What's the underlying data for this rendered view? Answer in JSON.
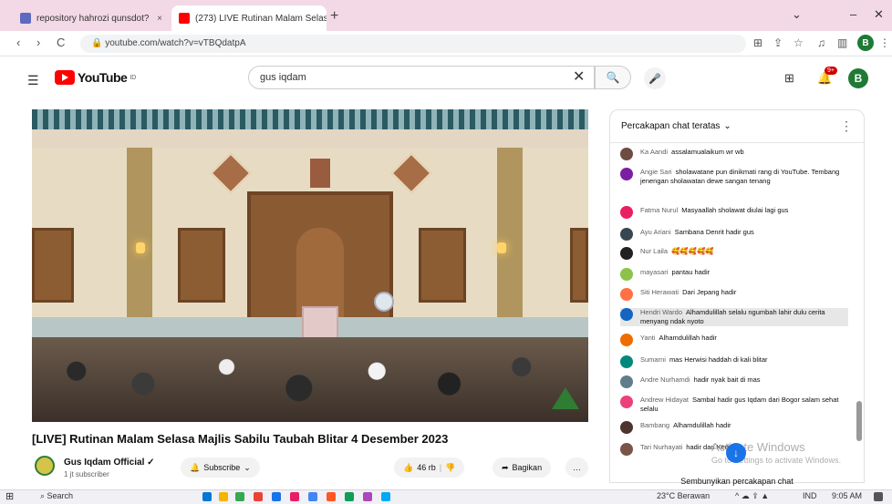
{
  "browser": {
    "tabs": [
      {
        "title": "repository hahrozi qunsdot?",
        "close": "×"
      },
      {
        "title": "(273) LIVE Rutinan Malam Selasa",
        "close": "×"
      }
    ],
    "new_tab": "+",
    "window_controls": {
      "chevron": "⌄",
      "minimize": "–",
      "close": "✕"
    },
    "nav": {
      "back": "‹",
      "forward": "›",
      "reload": "C"
    },
    "url": "youtube.com/watch?v=vTBQdatpA",
    "profile_initial": "B"
  },
  "youtube": {
    "logo_text": "YouTube",
    "logo_suffix": "ID",
    "search_value": "gus iqdam",
    "search_clear": "✕",
    "notification_count": "9+",
    "profile_initial": "B"
  },
  "video": {
    "title": "[LIVE] Rutinan Malam Selasa Majlis Sabilu Taubah Blitar 4 Desember 2023",
    "channel_name": "Gus Iqdam Official ✓",
    "subscribers": "1 jt subscriber",
    "subscribe_label": "Subscribe",
    "likes": "46 rb",
    "share_label": "Bagikan",
    "more": "…"
  },
  "chat": {
    "header": "Percakapan chat teratas",
    "header_chevron": "⌄",
    "messages": [
      {
        "name": "Ka Aandi",
        "text": "assalamualaikum wr wb",
        "color": "#6d4c41"
      },
      {
        "name": "Angie Sari",
        "text": "sholawatane pun dinikmati rang di YouTube. Tembang jenengan sholawatan dewe sangan tenang",
        "color": "#7b1fa2"
      },
      {
        "name": "Fatma Nurul",
        "text": "Masyaallah sholawat diulai lagi gus",
        "color": "#e91e63"
      },
      {
        "name": "Ayu Ariani",
        "text": "Sambana Denrit hadir gus",
        "color": "#37474f"
      },
      {
        "name": "Nur Laila",
        "text": "🥰🥰🥰🥰🥰",
        "color": "#212121"
      },
      {
        "name": "mayasari",
        "text": "pantau hadir",
        "color": "#8bc34a"
      },
      {
        "name": "Siti Herawati",
        "text": "Dari Jepang hadir",
        "color": "#ff7043"
      },
      {
        "name": "Hendri Wardo",
        "text": "Alhamdulillah selalu ngumbah lahir dulu cerita menyang ndak nyoto",
        "color": "#1565c0",
        "highlight": true
      },
      {
        "name": "Yanti",
        "text": "Alhamdulillah hadir",
        "color": "#ef6c00"
      },
      {
        "name": "Sumarni",
        "text": "mas Herwisi haddah di kali blitar",
        "color": "#00897b"
      },
      {
        "name": "Andre Nurhamdi",
        "text": "hadir nyak bait di mas",
        "color": "#607d8b"
      },
      {
        "name": "Andrew Hidayat",
        "text": "Sambal hadir gus Iqdam dari Bogor salam sehat selalu",
        "color": "#ec407a"
      },
      {
        "name": "Bambang",
        "text": "Alhamdulillah hadir",
        "color": "#4e342e"
      },
      {
        "name": "Tari Nurhayati",
        "text": "hadir dari Kediri",
        "color": "#795548"
      }
    ],
    "hide_label": "Sembunyikan percakapan chat",
    "jump_icon": "↓"
  },
  "watermark": {
    "title": "Activate Windows",
    "subtitle": "Go to Settings to activate Windows."
  },
  "taskbar": {
    "search": "Search",
    "weather": "23°C Berawan",
    "lang": "IND",
    "time": "9:05 AM"
  }
}
